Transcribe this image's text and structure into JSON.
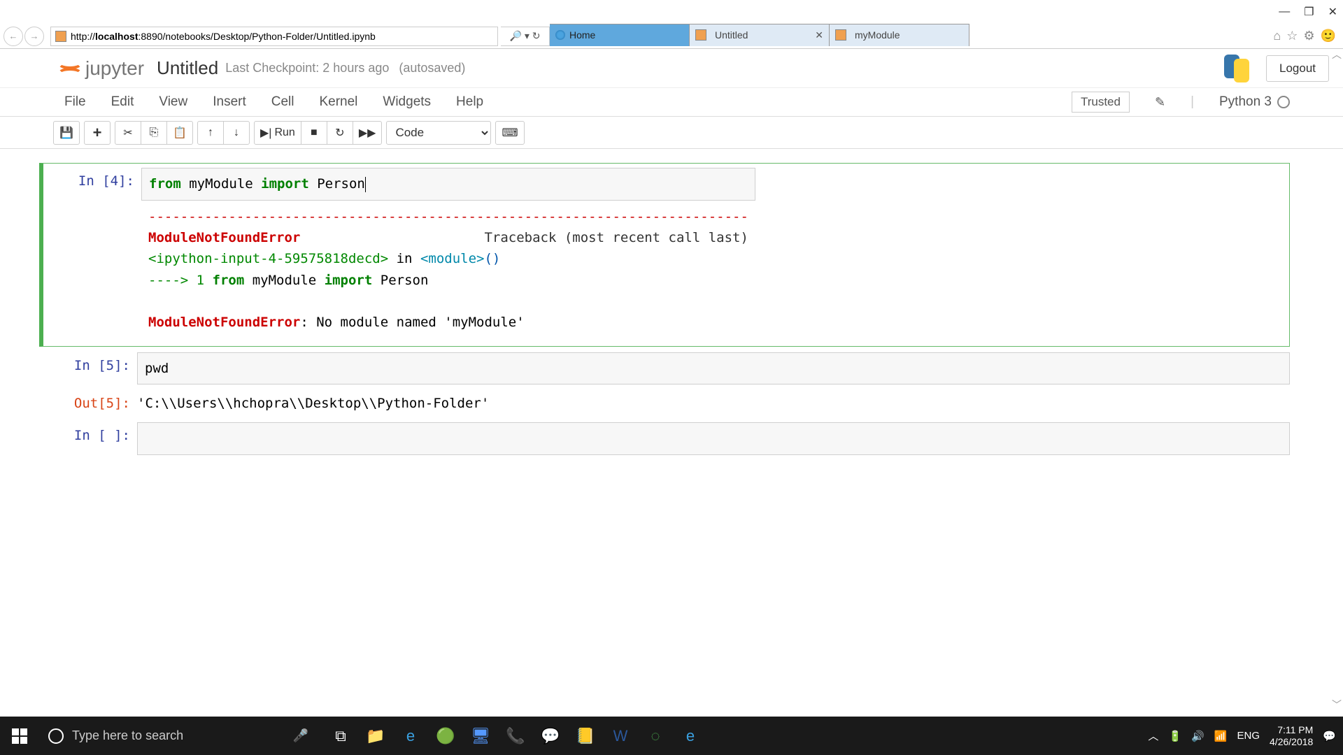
{
  "window": {
    "min": "—",
    "max": "❐",
    "close": "✕"
  },
  "browser": {
    "url_host": "localhost",
    "url_rest": ":8890/notebooks/Desktop/Python-Folder/Untitled.ipynb",
    "search_icons": "🔎 ▾ ↻",
    "tabs": [
      {
        "label": "Home",
        "active": true,
        "favicon": "ie"
      },
      {
        "label": "Untitled",
        "active": false,
        "favicon": "j",
        "close": true
      },
      {
        "label": "myModule",
        "active": false,
        "favicon": "j"
      }
    ],
    "icons": {
      "home": "⌂",
      "star": "☆",
      "gear": "⚙",
      "smile": "🙂"
    }
  },
  "jupyter": {
    "logo": "jupyter",
    "title": "Untitled",
    "checkpoint": "Last Checkpoint: 2 hours ago",
    "autosaved": "(autosaved)",
    "logout": "Logout",
    "menus": [
      "File",
      "Edit",
      "View",
      "Insert",
      "Cell",
      "Kernel",
      "Widgets",
      "Help"
    ],
    "trusted": "Trusted",
    "kernel": "Python 3",
    "cell_type": "Code",
    "toolbar": {
      "save": "💾",
      "add": "+",
      "cut": "✂",
      "copy": "📄",
      "paste": "📋",
      "up": "↑",
      "down": "↓",
      "run": "▶I Run",
      "run_label": "Run",
      "stop": "■",
      "restart": "↻",
      "ff": "▶▶",
      "keyboard": "⌨"
    }
  },
  "cells": {
    "c1": {
      "in_prompt": "In [4]:",
      "code_parts": {
        "from": "from",
        "mod": " myModule ",
        "import": "import",
        "person": " Person"
      },
      "err": {
        "dashes": "---------------------------------------------------------------------------",
        "name": "ModuleNotFoundError",
        "tb": "                       Traceback (most recent call last)",
        "ipyin": "<ipython-input-4-59575818decd>",
        "in": " in ",
        "module": "<module>",
        "parens": "()",
        "arrow": "----> 1 ",
        "from2": "from",
        "mod2": " myModule ",
        "import2": "import",
        "person2": " Person",
        "final_name": "ModuleNotFoundError",
        "final_colon": ": ",
        "final_msg": "No module named 'myModule'"
      }
    },
    "c2": {
      "in_prompt": "In [5]:",
      "code": "pwd",
      "out_prompt": "Out[5]:",
      "out_text": "'C:\\\\Users\\\\hchopra\\\\Desktop\\\\Python-Folder'"
    },
    "c3": {
      "in_prompt": "In [ ]:"
    }
  },
  "taskbar": {
    "search_placeholder": "Type here to search",
    "lang": "ENG",
    "time": "7:11 PM",
    "date": "4/26/2018"
  }
}
